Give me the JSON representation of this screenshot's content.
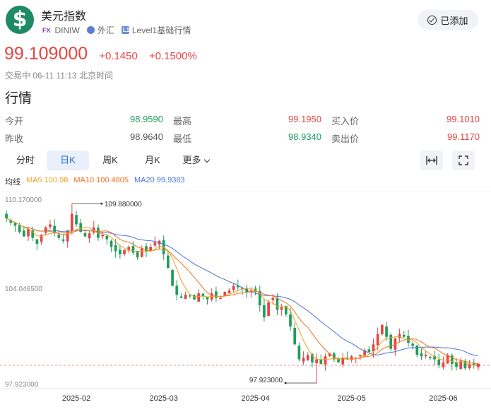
{
  "header": {
    "title": "美元指数",
    "logo_glyph": "$",
    "code_badge": "FX",
    "code": "DINIW",
    "market": "外汇",
    "level_badge": "L1",
    "level": "Level1基础行情",
    "added_button": "已添加"
  },
  "quote": {
    "price": "99.109000",
    "change": "+0.1450",
    "change_pct": "+0.1500%",
    "status": "交易中 06-11 11:13 北京时间"
  },
  "section_title": "行情",
  "stats": [
    [
      {
        "label": "今开",
        "value": "98.9590",
        "color": "green"
      },
      {
        "label": "最高",
        "value": "99.1950",
        "color": "red"
      },
      {
        "label": "买入价",
        "value": "99.1010",
        "color": "red"
      }
    ],
    [
      {
        "label": "昨收",
        "value": "98.9640",
        "color": "gray"
      },
      {
        "label": "最低",
        "value": "98.9340",
        "color": "green"
      },
      {
        "label": "卖出价",
        "value": "99.1170",
        "color": "red"
      }
    ]
  ],
  "tabs": [
    "分时",
    "日K",
    "周K",
    "月K",
    "更多"
  ],
  "active_tab": 1,
  "toolbar_icons": [
    "fit-width-icon",
    "fullscreen-icon"
  ],
  "ma_legend": {
    "label": "均线",
    "ma5": "MA5 100.98",
    "ma10": "MA10 100.4805",
    "ma20": "MA20 99.9383"
  },
  "chart_data": {
    "type": "candlestick",
    "y_ticks": [
      "110.170000",
      "104.046500",
      "97.923000"
    ],
    "ylim": [
      97.923,
      110.17
    ],
    "x_ticks": [
      {
        "label": "2025-02",
        "index": 16
      },
      {
        "label": "2025-03",
        "index": 36
      },
      {
        "label": "2025-04",
        "index": 57
      },
      {
        "label": "2025-05",
        "index": 79
      },
      {
        "label": "2025-06",
        "index": 100
      }
    ],
    "high_annotation": {
      "value": "109.880000",
      "index": 15
    },
    "low_annotation": {
      "value": "97.923000",
      "index": 71
    },
    "current_price_line": 99.109,
    "colors": {
      "up": "#e64545",
      "down": "#1e9e5a",
      "ma5": "#f0a020",
      "ma10": "#f07020",
      "ma20": "#4a73d8"
    },
    "closes": [
      108.9,
      108.6,
      108.4,
      108.0,
      107.7,
      108.2,
      107.6,
      107.2,
      107.8,
      108.3,
      108.5,
      107.9,
      107.6,
      107.4,
      108.1,
      109.2,
      108.5,
      108.0,
      107.7,
      107.9,
      108.3,
      107.6,
      107.8,
      107.5,
      107.0,
      106.7,
      106.5,
      106.8,
      107.0,
      106.6,
      106.3,
      106.9,
      106.7,
      107.0,
      107.3,
      107.4,
      106.5,
      105.6,
      104.4,
      103.8,
      103.6,
      103.8,
      103.7,
      103.5,
      103.9,
      103.7,
      103.5,
      103.9,
      103.6,
      103.6,
      104.0,
      104.1,
      104.4,
      104.3,
      104.2,
      104.0,
      104.1,
      104.0,
      103.1,
      102.3,
      103.3,
      103.6,
      102.8,
      103.0,
      102.5,
      101.7,
      100.5,
      99.5,
      99.6,
      99.8,
      99.3,
      99.5,
      99.2,
      99.7,
      99.9,
      99.5,
      99.3,
      99.6,
      99.5,
      99.7,
      99.6,
      99.8,
      100.1,
      100.0,
      100.5,
      101.2,
      101.8,
      101.0,
      100.2,
      100.9,
      101.2,
      101.0,
      100.6,
      100.4,
      99.8,
      99.7,
      99.8,
      99.6,
      99.5,
      99.1,
      99.3,
      99.8,
      99.2,
      99.0,
      99.4,
      98.9,
      99.2,
      99.1,
      99.1
    ]
  }
}
